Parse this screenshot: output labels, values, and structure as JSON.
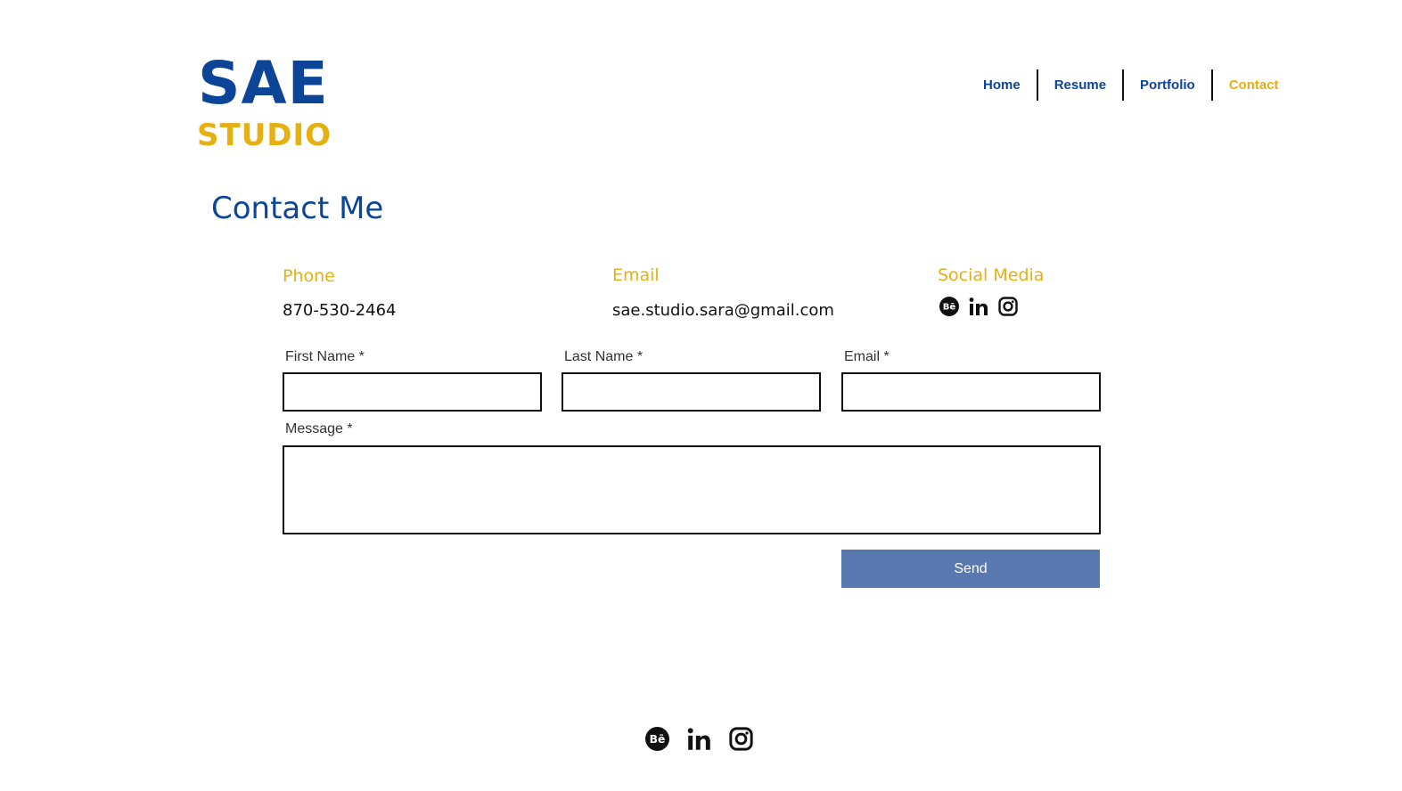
{
  "logo": {
    "top": "SAE",
    "bottom": "STUDIO"
  },
  "nav": {
    "items": [
      {
        "label": "Home"
      },
      {
        "label": "Resume"
      },
      {
        "label": "Portfolio"
      },
      {
        "label": "Contact",
        "active": true
      }
    ]
  },
  "page": {
    "title": "Contact Me"
  },
  "info": {
    "phone": {
      "label": "Phone",
      "value": "870-530-2464"
    },
    "email": {
      "label": "Email",
      "value": "sae.studio.sara@gmail.com"
    },
    "social": {
      "label": "Social Media",
      "icons": [
        "behance-icon",
        "linkedin-icon",
        "instagram-icon"
      ]
    }
  },
  "form": {
    "first_name_label": "First Name *",
    "first_name_value": "",
    "last_name_label": "Last Name *",
    "last_name_value": "",
    "email_label": "Email *",
    "email_value": "",
    "message_label": "Message *",
    "message_value": "",
    "send_label": "Send"
  },
  "footer": {
    "icons": [
      "behance-icon",
      "linkedin-icon",
      "instagram-icon"
    ]
  },
  "colors": {
    "brand_blue": "#0c4597",
    "brand_yellow": "#e6b012",
    "button": "#5a78b0",
    "text": "#111111"
  }
}
